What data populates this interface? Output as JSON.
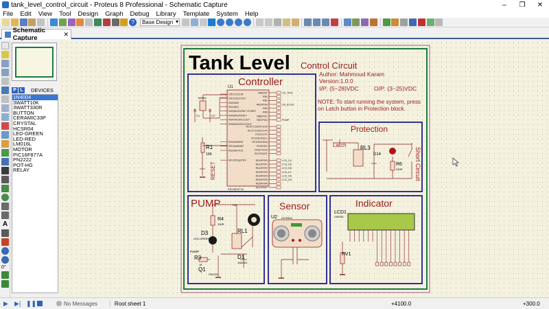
{
  "window": {
    "title": "tank_level_control_circuit - Proteus 8 Professional - Schematic Capture",
    "minimize": "–",
    "maximize": "❐",
    "close": "✕"
  },
  "menu": [
    "File",
    "Edit",
    "View",
    "Tool",
    "Design",
    "Graph",
    "Debug",
    "Library",
    "Template",
    "System",
    "Help"
  ],
  "toolbar": {
    "design_select": "Base Design"
  },
  "tab": {
    "label": "Schematic Capture",
    "close": "✕"
  },
  "devices_panel": {
    "p_label": "P",
    "l_label": "L",
    "title": "DEVICES",
    "items": [
      "1N4004",
      "3WATT10K",
      "3WATT330R",
      "BUTTON",
      "CERAMIC33P",
      "CRYSTAL",
      "HCSR04",
      "LED-GREEN",
      "LED-RED",
      "LM016L",
      "MOTOR",
      "PIC16F877A",
      "PN2222",
      "POT-HG",
      "RELAY"
    ],
    "selected_index": 0
  },
  "left_tools": {
    "rotate_value": "0°"
  },
  "schematic": {
    "title": "Tank Level",
    "subtitle": "Control Circuit",
    "author": "Author: Mahmoud Karam",
    "version": "Version:1.0.0",
    "io_in": "I/P: (5~28)VDC",
    "io_out": "O/P: (3~25)VDC",
    "note": "NOTE: To start running the system, press on Latch button in Protection block.",
    "blocks": {
      "controller": "Controller",
      "protection": "Protection",
      "pump": "PUMP",
      "sensor": "Sensor",
      "indicator": "Indicator"
    },
    "labels": {
      "u1": "U1",
      "u1_part": "PIC16F877A",
      "x1": "16MHz",
      "c1": "C1",
      "c2": "C2",
      "r1": "R1",
      "r1_val": "10K",
      "reset": "RESET",
      "latch": "Latch",
      "rl3": "RL3",
      "d14": "D14",
      "r6": "R6",
      "r6_val": "330R",
      "short_circuit": "Short Circuit",
      "r4": "R4",
      "r4_val": "330R",
      "d3": "D3",
      "d3_part": "LED-GREEN",
      "rl1": "RL1",
      "d1": "D1",
      "d1_part": "1N4004",
      "pump_sig": "PUMP",
      "r3": "R3",
      "r3_val": "1K",
      "q1": "Q1",
      "q1_part": "PN2222",
      "u2": "U2",
      "u2_part": "HCSR04",
      "lcd1": "LCD1",
      "lcd1_part": "LM016L",
      "rv1": "RV1",
      "vdd": "+5V"
    },
    "u1_left_pins": [
      "OSC1/CLKIN",
      "OSC2/CLKOUT",
      "RA0/AN0",
      "RA1/AN1",
      "RA2/AN2/VREF-/CVREF",
      "RA3/AN3/VREF+",
      "RA4/T0CKI/C1OUT",
      "RA5/AN4/SS/C2OUT",
      "RE0/AN5/RD",
      "RE1/AN6/WR",
      "RE2/AN7/CS",
      "MCLR/Vpp/THV"
    ],
    "u1_right_pins": [
      "RB0/INT",
      "RB1",
      "RB2",
      "RB3/PGM",
      "RB4",
      "RB5",
      "RB6/PGC",
      "RB7/PGD",
      "RC0/T1OSO/T1CKI",
      "RC1/T1OSI/CCP2",
      "RC2/CCP1",
      "RC3/SCK/SCL",
      "RC4/SDI/SDA",
      "RC5/SDO",
      "RC6/TX/CK",
      "RC7/RX/DT",
      "RD0/PSP0",
      "RD1/PSP1",
      "RD2/PSP2",
      "RD3/PSP3",
      "RD4/PSP4",
      "RD5/PSP5",
      "RD6/PSP6",
      "RD7/PSP7"
    ],
    "u1_right_nets": [
      "US_TRIG",
      "",
      "",
      "US_ECHO",
      "",
      "",
      "",
      "PUMP",
      "",
      "",
      "",
      "",
      "",
      "",
      "",
      "",
      "LCD_D4",
      "LCD_D5",
      "LCD_D6",
      "LCD_D7",
      "LCD_RS",
      "LCD_EN",
      "",
      ""
    ]
  },
  "status": {
    "messages": "No Messages",
    "sheet": "Root sheet 1",
    "x": "+4100.0",
    "y": "+300.0"
  },
  "colors": {
    "sheet_border": "#1b7a3e",
    "block_border": "#1c1c8c",
    "component_red": "#a01818",
    "ic_fill": "#f2ddc8",
    "lcd_green": "#a8c84a"
  }
}
